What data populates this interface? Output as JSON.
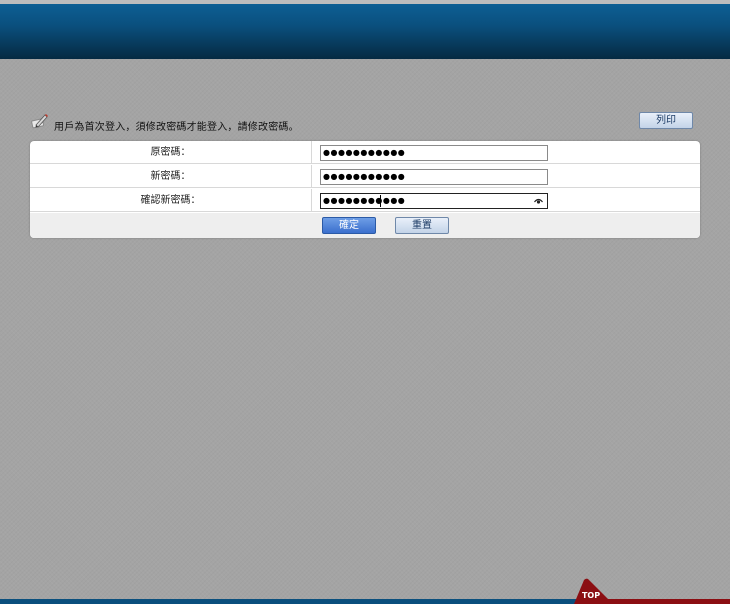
{
  "notice": {
    "icon": "edit-pencil-icon",
    "text": "用戶為首次登入，須修改密碼才能登入，請修改密碼。"
  },
  "toolbar": {
    "print_label": "列印"
  },
  "form": {
    "rows": [
      {
        "label": "原密碼：",
        "value": "●●●●●●●●●●●"
      },
      {
        "label": "新密碼：",
        "value": "●●●●●●●●●●●"
      },
      {
        "label": "確認新密碼：",
        "value": "●●●●●●●●●●●"
      }
    ],
    "reveal_icon": "show-password-icon",
    "confirm_label": "確定",
    "reset_label": "重置"
  },
  "footer": {
    "top_label": "TOP"
  },
  "colors": {
    "header": "#0a4f7d",
    "background": "#a4a4a4",
    "primary_button": "#3b6fcd",
    "top_tab": "#8b0e12"
  }
}
